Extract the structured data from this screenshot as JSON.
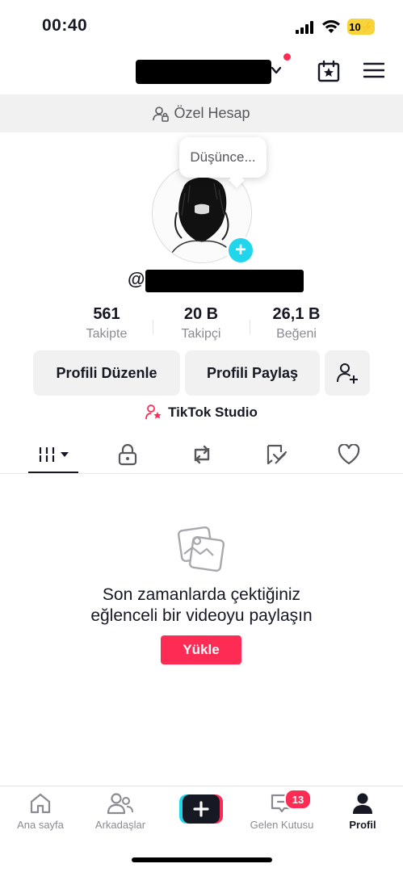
{
  "status_bar": {
    "time": "00:40",
    "battery": "10"
  },
  "header": {
    "chevron": "chevron-down-icon"
  },
  "private_banner": {
    "label": "Özel Hesap"
  },
  "profile": {
    "thought_bubble": "Düşünce...",
    "add_icon": "+",
    "username_prefix": "@"
  },
  "stats": [
    {
      "value": "561",
      "label": "Takipte"
    },
    {
      "value": "20 B",
      "label": "Takipçi"
    },
    {
      "value": "26,1 B",
      "label": "Beğeni"
    }
  ],
  "actions": {
    "edit": "Profili Düzenle",
    "share": "Profili Paylaş"
  },
  "studio": {
    "label": "TikTok Studio"
  },
  "tabs": [
    "videos-grid",
    "private",
    "reposts",
    "tagged",
    "liked"
  ],
  "empty_state": {
    "line1": "Son zamanlarda çektiğiniz",
    "line2": "eğlenceli bir videoyu paylaşın",
    "button": "Yükle"
  },
  "bottom_nav": {
    "home": "Ana sayfa",
    "friends": "Arkadaşlar",
    "inbox": "Gelen Kutusu",
    "inbox_badge": "13",
    "profile": "Profil"
  },
  "colors": {
    "accent": "#fe2c55",
    "cyan": "#20d5ec",
    "muted": "#8a8b91"
  }
}
